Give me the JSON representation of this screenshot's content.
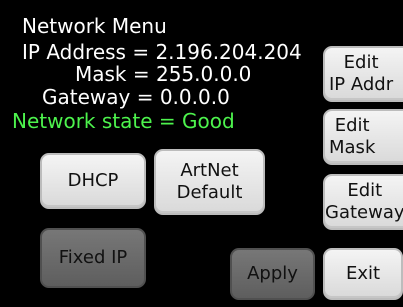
{
  "menu": {
    "title": "Network Menu",
    "ip_line": "IP Address = 2.196.204.204",
    "mask_line": "Mask = 255.0.0.0",
    "gateway_line": "Gateway = 0.0.0.0",
    "state_line": "Network state = Good"
  },
  "buttons": {
    "dhcp": "DHCP",
    "artnet_line1": "ArtNet",
    "artnet_line2": "Default",
    "fixed_ip": "Fixed IP",
    "apply": "Apply",
    "exit": "Exit",
    "edit_ip_line1": "Edit",
    "edit_ip_line2": "IP Addr",
    "edit_mask_line1": "Edit",
    "edit_mask_line2": "Mask",
    "edit_gw_line1": "Edit",
    "edit_gw_line2": "Gateway"
  },
  "colors": {
    "background": "#000000",
    "text": "#ffffff",
    "state_good": "#4df34d",
    "button_light": "#e6e6e6",
    "button_dark": "#6a6a6a"
  }
}
